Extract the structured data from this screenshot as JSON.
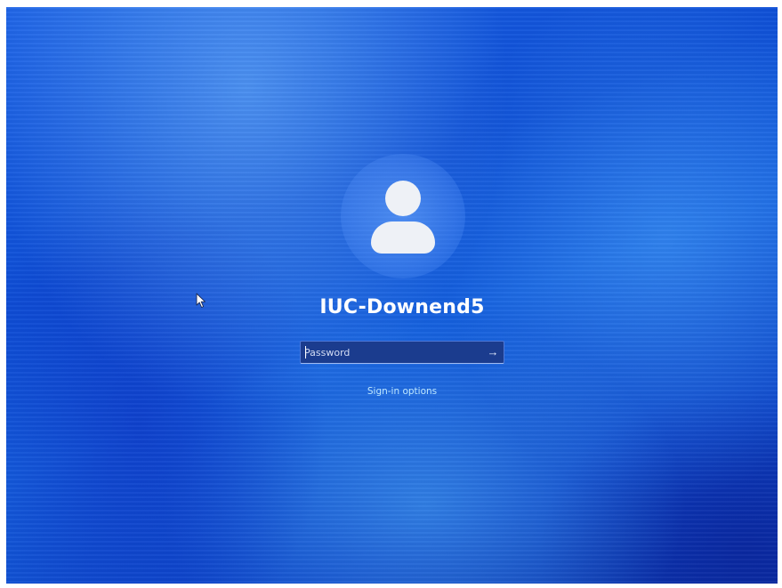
{
  "user": {
    "name": "IUC-Downend5",
    "avatar_icon": "user-silhouette-icon"
  },
  "password": {
    "value": "",
    "placeholder": "Password",
    "submit_icon": "arrow-right-icon",
    "submit_glyph": "→"
  },
  "links": {
    "sign_in_options": "Sign-in options"
  },
  "colors": {
    "background": "#1058dc",
    "input_background": "#1b3c8e",
    "link": "#bfe8ff",
    "text": "#ffffff"
  }
}
